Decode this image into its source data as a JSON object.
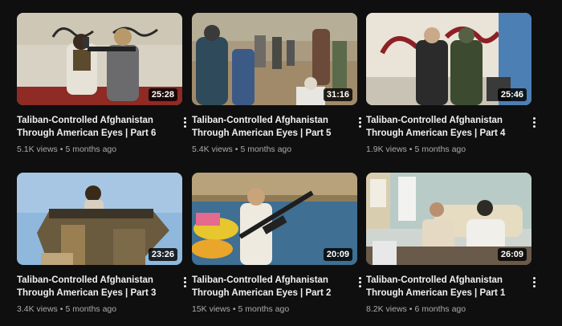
{
  "videos": [
    {
      "title_line1": "Taliban-Controlled Afghanistan",
      "title_line2": "Through American Eyes | Part 6",
      "views": "5.1K views",
      "age": "5 months ago",
      "duration": "25:28",
      "menu_icon": "more-vert-icon"
    },
    {
      "title_line1": "Taliban-Controlled Afghanistan",
      "title_line2": "Through American Eyes | Part 5",
      "views": "5.4K views",
      "age": "5 months ago",
      "duration": "31:16",
      "menu_icon": "more-vert-icon"
    },
    {
      "title_line1": "Taliban-Controlled Afghanistan",
      "title_line2": "Through American Eyes | Part 4",
      "views": "1.9K views",
      "age": "5 months ago",
      "duration": "25:46",
      "menu_icon": "more-vert-icon"
    },
    {
      "title_line1": "Taliban-Controlled Afghanistan",
      "title_line2": "Through American Eyes | Part 3",
      "views": "3.4K views",
      "age": "5 months ago",
      "duration": "23:26",
      "menu_icon": "more-vert-icon"
    },
    {
      "title_line1": "Taliban-Controlled Afghanistan",
      "title_line2": "Through American Eyes | Part 2",
      "views": "15K views",
      "age": "5 months ago",
      "duration": "20:09",
      "menu_icon": "more-vert-icon"
    },
    {
      "title_line1": "Taliban-Controlled Afghanistan",
      "title_line2": "Through American Eyes | Part 1",
      "views": "8.2K views",
      "age": "6 months ago",
      "duration": "26:09",
      "menu_icon": "more-vert-icon"
    }
  ],
  "separator": "•",
  "colors": {
    "background": "#0f0f0f",
    "title": "#f1f1f1",
    "meta": "#aaaaaa"
  }
}
